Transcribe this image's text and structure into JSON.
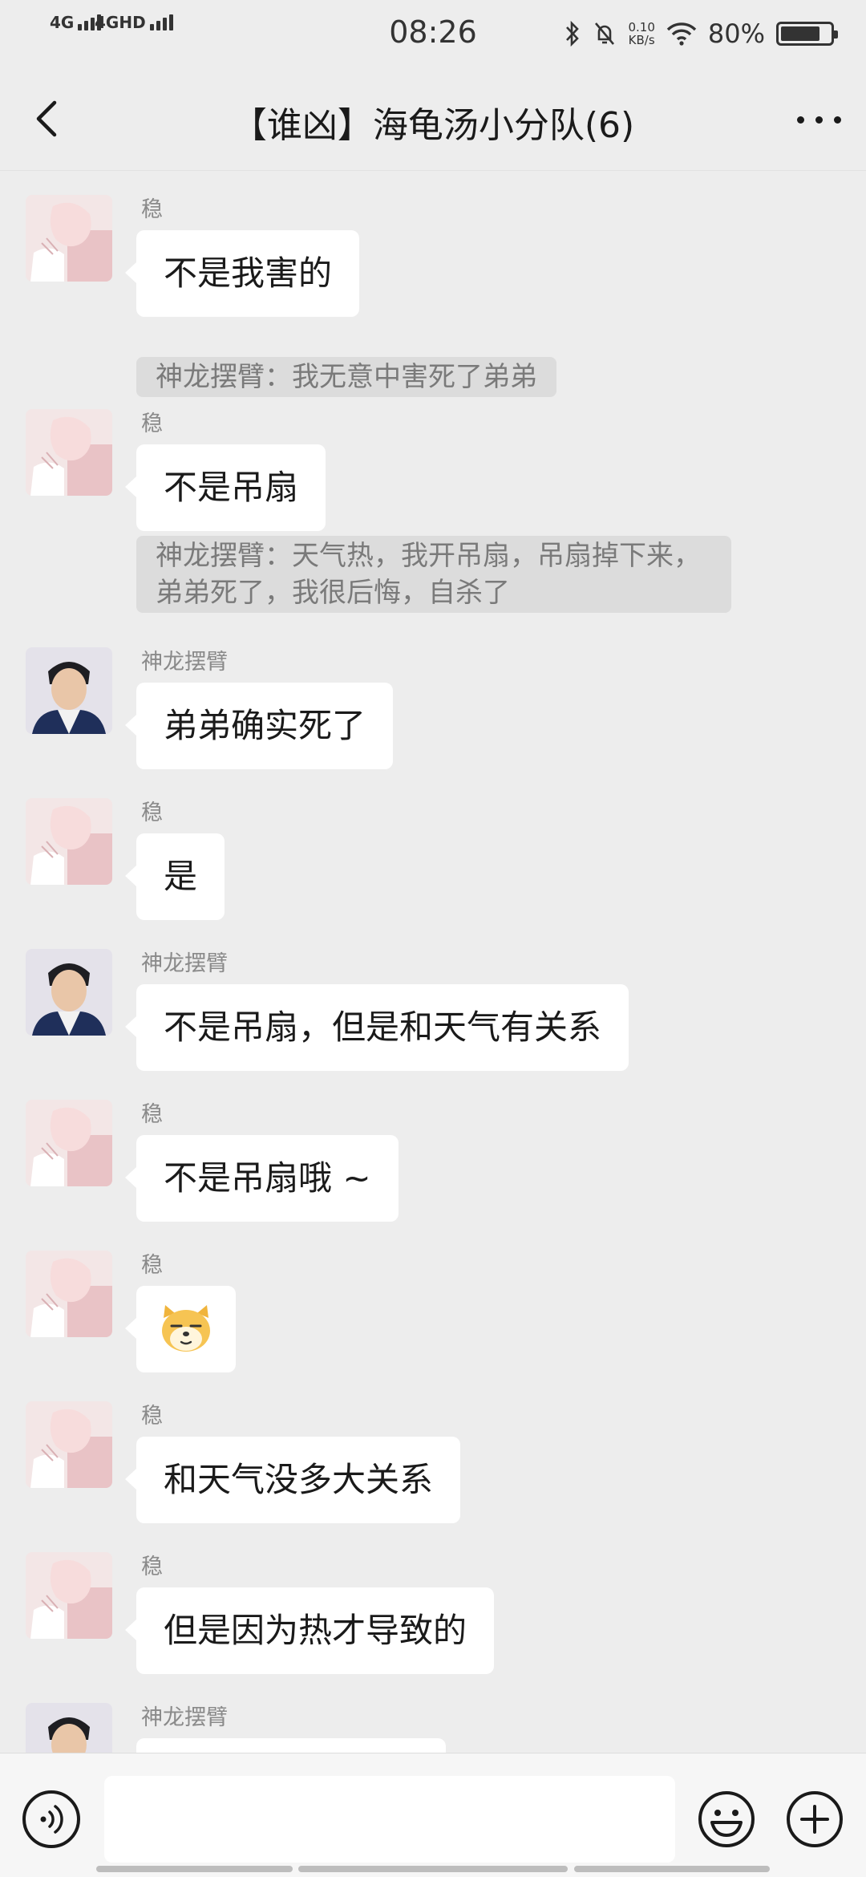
{
  "status_bar": {
    "net1": "4G",
    "net2": "4GHD",
    "time": "08:26",
    "speed_value": "0.10",
    "speed_unit": "KB/s",
    "battery": "80%",
    "battery_level": 0.8
  },
  "header": {
    "title": "【谁凶】海龟汤小分队(6)",
    "back_icon": "chevron-left-icon",
    "more_icon": "more-dots-icon"
  },
  "messages": [
    {
      "sender": "稳",
      "text": "不是我害的",
      "quote": "神龙摆臂：我无意中害死了弟弟"
    },
    {
      "sender": "稳",
      "text": "不是吊扇",
      "quote": "神龙摆臂：天气热，我开吊扇，吊扇掉下来，弟弟死了，我很后悔，自杀了"
    },
    {
      "sender": "神龙摆臂",
      "text": "弟弟确实死了"
    },
    {
      "sender": "稳",
      "text": "是"
    },
    {
      "sender": "神龙摆臂",
      "text": "不是吊扇，但是和天气有关系"
    },
    {
      "sender": "稳",
      "text": "不是吊扇哦 ~"
    },
    {
      "sender": "稳",
      "text": "",
      "sticker": "doge-emoji-icon"
    },
    {
      "sender": "稳",
      "text": "和天气没多大关系"
    },
    {
      "sender": "稳",
      "text": "但是因为热才导致的"
    },
    {
      "sender": "神龙摆臂",
      "text": ""
    }
  ],
  "input_bar": {
    "voice_icon": "voice-icon",
    "emoji_icon": "emoji-icon",
    "plus_icon": "plus-icon"
  },
  "colors": {
    "background": "#ededed",
    "bubble": "#ffffff",
    "quote_bg": "#dcdcdc",
    "sender_text": "#8a8a8a"
  }
}
